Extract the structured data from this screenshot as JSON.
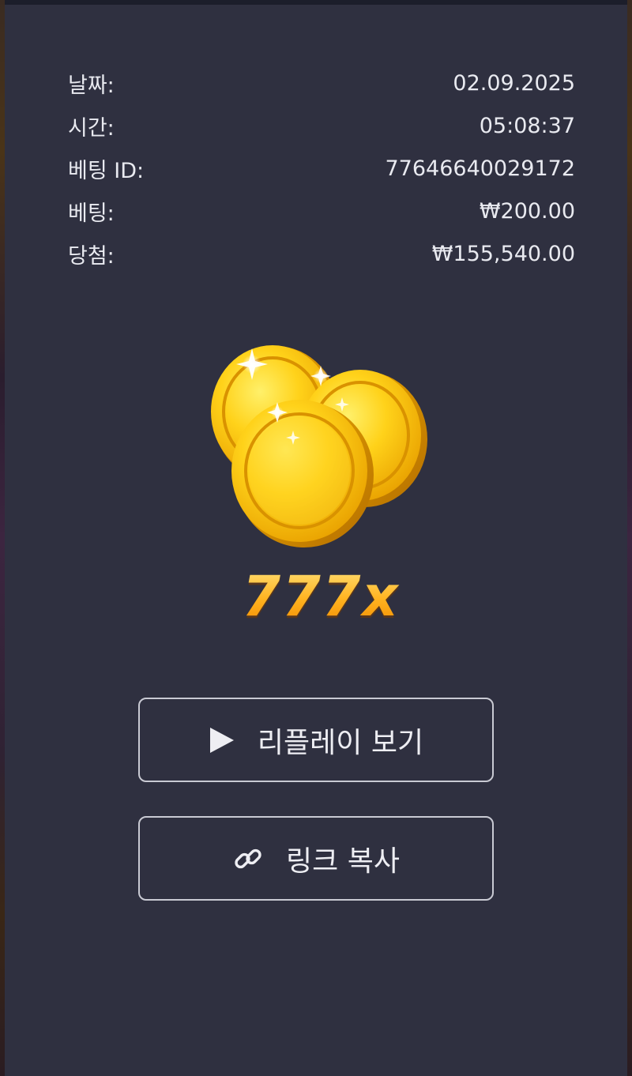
{
  "bet_info": {
    "rows": [
      {
        "label": "날짜:",
        "value": "02.09.2025"
      },
      {
        "label": "시간:",
        "value": "05:08:37"
      },
      {
        "label": "베팅 ID:",
        "value": "77646640029172"
      },
      {
        "label": "베팅:",
        "value": "₩200.00"
      },
      {
        "label": "당첨:",
        "value": "₩155,540.00"
      }
    ]
  },
  "result": {
    "multiplier": "777x",
    "image": "gold-coins-icon"
  },
  "actions": {
    "replay_label": "리플레이 보기",
    "replay_icon": "play-icon",
    "copy_link_label": "링크 복사",
    "copy_link_icon": "link-icon"
  },
  "colors": {
    "panel_bg": "#2f3040",
    "text": "#e9eaf0",
    "accent_gold": "#ffb21f",
    "button_border": "#c9cad3"
  }
}
